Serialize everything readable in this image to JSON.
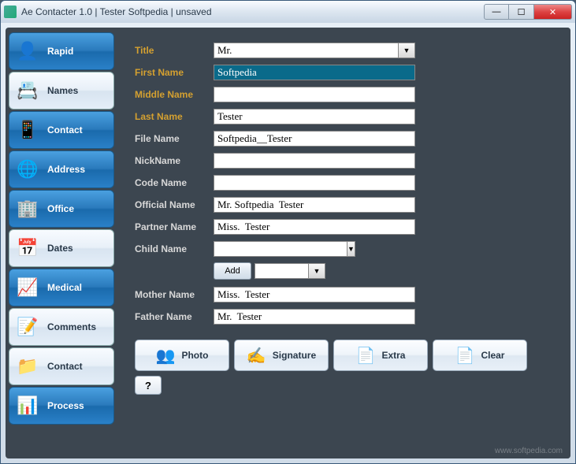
{
  "window": {
    "title": "Ae Contacter 1.0 | Tester Softpedia | unsaved"
  },
  "sidebar": {
    "items": [
      {
        "label": "Rapid",
        "icon": "👤",
        "active": true
      },
      {
        "label": "Names",
        "icon": "📇",
        "active": false
      },
      {
        "label": "Contact",
        "icon": "📱",
        "active": true
      },
      {
        "label": "Address",
        "icon": "🌐",
        "active": true
      },
      {
        "label": "Office",
        "icon": "🏢",
        "active": true
      },
      {
        "label": "Dates",
        "icon": "📅",
        "active": false
      },
      {
        "label": "Medical",
        "icon": "📈",
        "active": true
      },
      {
        "label": "Comments",
        "icon": "📝",
        "active": false
      },
      {
        "label": "Contact",
        "icon": "📁",
        "active": false
      },
      {
        "label": "Process",
        "icon": "📊",
        "active": true
      }
    ]
  },
  "form": {
    "title": {
      "label": "Title",
      "value": "Mr."
    },
    "firstName": {
      "label": "First Name",
      "value": "Softpedia"
    },
    "middleName": {
      "label": "Middle Name",
      "value": ""
    },
    "lastName": {
      "label": "Last Name",
      "value": "Tester"
    },
    "fileName": {
      "label": "File Name",
      "value": "Softpedia__Tester"
    },
    "nickName": {
      "label": "NickName",
      "value": ""
    },
    "codeName": {
      "label": "Code Name",
      "value": ""
    },
    "officialName": {
      "label": "Official Name",
      "value": "Mr. Softpedia  Tester"
    },
    "partnerName": {
      "label": "Partner Name",
      "value": "Miss.  Tester"
    },
    "childName": {
      "label": "Child Name",
      "value": ""
    },
    "addLabel": "Add",
    "motherName": {
      "label": "Mother Name",
      "value": "Miss.  Tester"
    },
    "fatherName": {
      "label": "Father Name",
      "value": "Mr.  Tester"
    }
  },
  "actions": {
    "photo": "Photo",
    "signature": "Signature",
    "extra": "Extra",
    "clear": "Clear",
    "help": "?"
  },
  "watermark": "www.softpedia.com"
}
